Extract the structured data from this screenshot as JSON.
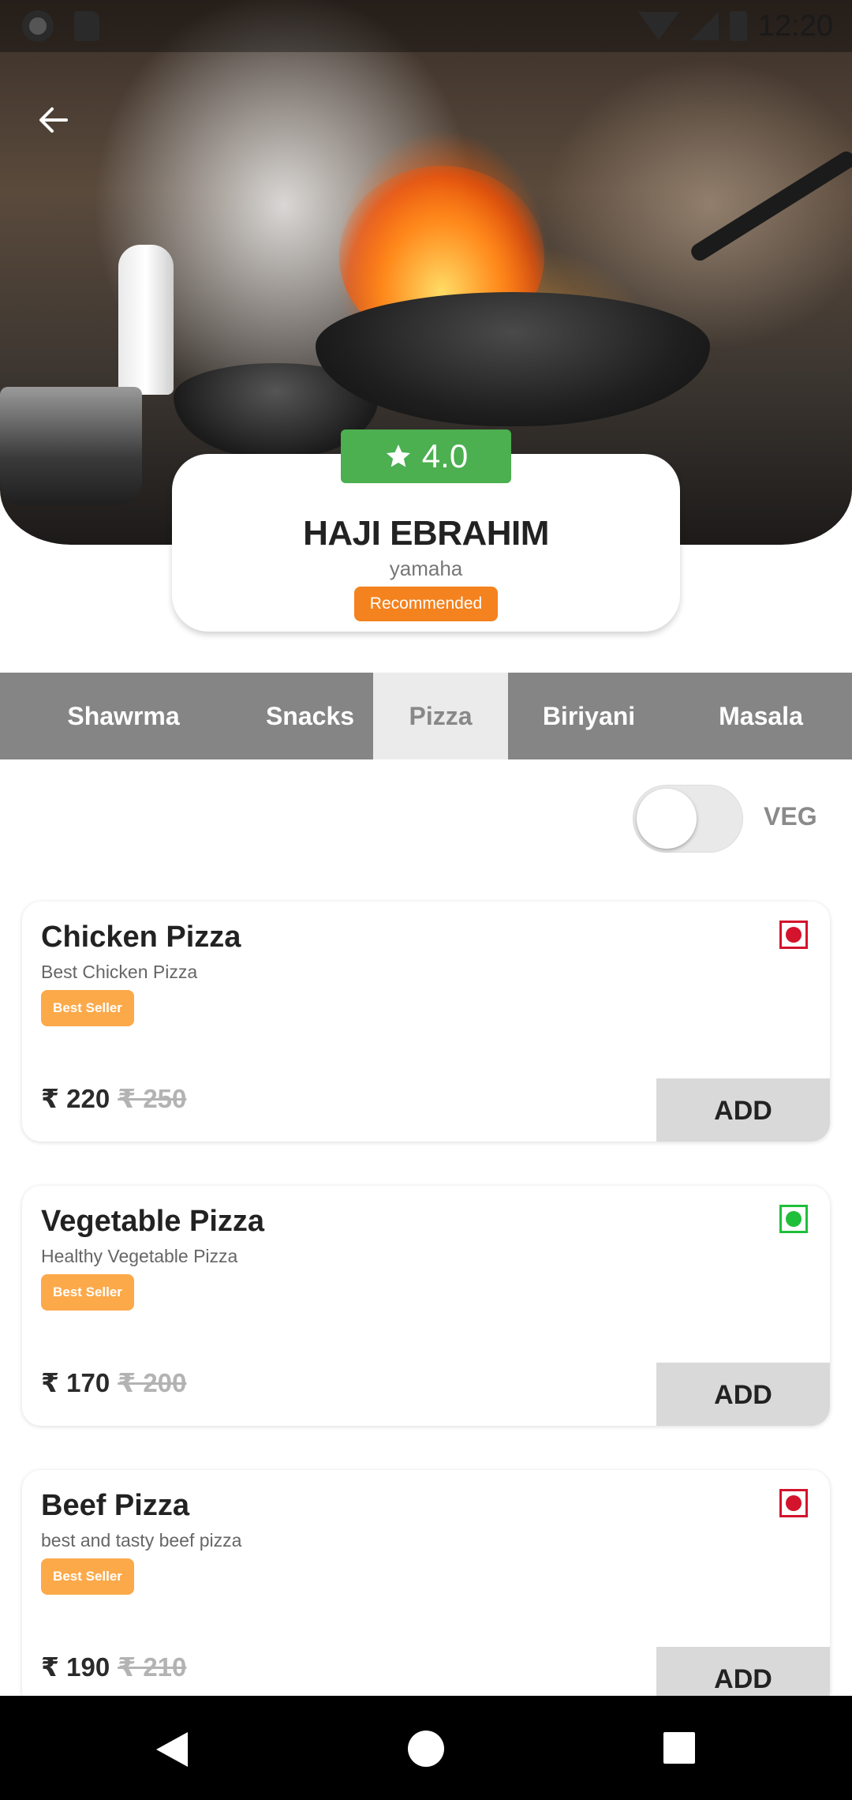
{
  "status_bar": {
    "time": "12:20"
  },
  "restaurant": {
    "rating": "4.0",
    "name": "HAJI EBRAHIM",
    "subtitle": "yamaha",
    "badge": "Recommended"
  },
  "tabs": [
    {
      "label": "Shawrma",
      "active": false
    },
    {
      "label": "Snacks",
      "active": false
    },
    {
      "label": "Pizza",
      "active": true
    },
    {
      "label": "Biriyani",
      "active": false
    },
    {
      "label": "Masala",
      "active": false
    }
  ],
  "filter": {
    "veg_label": "VEG",
    "veg_only": false
  },
  "items": [
    {
      "name": "Chicken Pizza",
      "description": "Best Chicken Pizza",
      "badge": "Best Seller",
      "price": "₹ 220",
      "old_price": "₹ 250",
      "diet": "non-veg",
      "add_label": "ADD"
    },
    {
      "name": "Vegetable Pizza",
      "description": "Healthy Vegetable Pizza",
      "badge": "Best Seller",
      "price": "₹ 170",
      "old_price": "₹ 200",
      "diet": "veg",
      "add_label": "ADD"
    },
    {
      "name": "Beef Pizza",
      "description": "best and tasty beef pizza",
      "badge": "Best Seller",
      "price": "₹ 190",
      "old_price": "₹ 210",
      "diet": "non-veg",
      "add_label": "ADD"
    }
  ],
  "colors": {
    "rating_green": "#4caf50",
    "recommended_orange": "#f4821e",
    "best_seller_orange": "#fca94a",
    "tab_bar_gray": "#858585",
    "nonveg_red": "#d3142c",
    "veg_green": "#1fbf3a"
  },
  "icons": {
    "back": "arrow-left-icon",
    "rating": "star-icon",
    "nav_back": "triangle-back-icon",
    "nav_home": "circle-home-icon",
    "nav_recent": "square-recents-icon"
  }
}
